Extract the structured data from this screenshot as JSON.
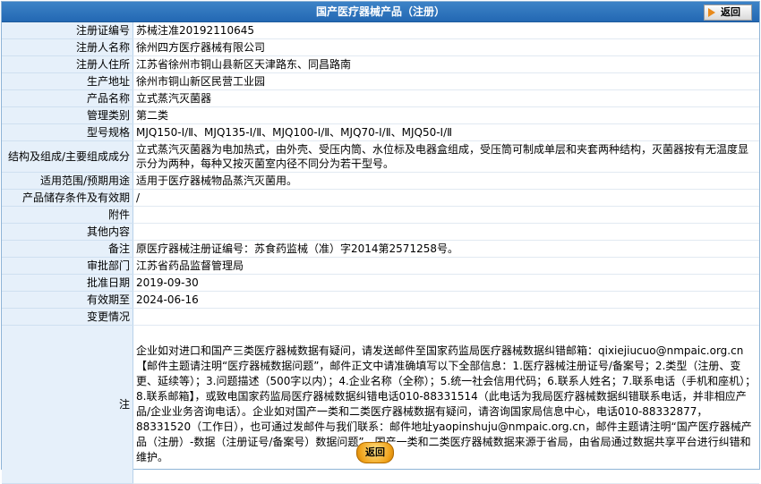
{
  "header": {
    "title": "国产医疗器械产品（注册）",
    "back_label": "返回"
  },
  "rows": [
    {
      "label": "注册证编号",
      "value": "苏械注准20192110645"
    },
    {
      "label": "注册人名称",
      "value": "徐州四方医疗器械有限公司"
    },
    {
      "label": "注册人住所",
      "value": "江苏省徐州市铜山县新区天津路东、同昌路南"
    },
    {
      "label": "生产地址",
      "value": "徐州市铜山新区民营工业园"
    },
    {
      "label": "产品名称",
      "value": "立式蒸汽灭菌器"
    },
    {
      "label": "管理类别",
      "value": "第二类"
    },
    {
      "label": "型号规格",
      "value": "MJQ150-Ⅰ/Ⅱ、MJQ135-Ⅰ/Ⅱ、MJQ100-Ⅰ/Ⅱ、MJQ70-Ⅰ/Ⅱ、MJQ50-Ⅰ/Ⅱ"
    },
    {
      "label": "结构及组成/主要组成成分",
      "value": "立式蒸汽灭菌器为电加热式，由外壳、受压内筒、水位标及电器盒组成，受压筒可制成单层和夹套两种结构，灭菌器按有无温度显示分为两种，每种又按灭菌室内径不同分为若干型号。"
    },
    {
      "label": "适用范围/预期用途",
      "value": "适用于医疗器械物品蒸汽灭菌用。"
    },
    {
      "label": "产品储存条件及有效期",
      "value": "/"
    },
    {
      "label": "附件",
      "value": ""
    },
    {
      "label": "其他内容",
      "value": ""
    },
    {
      "label": "备注",
      "value": "原医疗器械注册证编号：苏食药监械（准）字2014第2571258号。"
    },
    {
      "label": "审批部门",
      "value": "江苏省药品监督管理局"
    },
    {
      "label": "批准日期",
      "value": "2019-09-30"
    },
    {
      "label": "有效期至",
      "value": "2024-06-16"
    },
    {
      "label": "变更情况",
      "value": ""
    },
    {
      "label": "注",
      "value": "企业如对进口和国产三类医疗器械数据有疑问，请发送邮件至国家药监局医疗器械数据纠错邮箱：qixiejiucuo@nmpaic.org.cn【邮件主题请注明“医疗器械数据问题”，邮件正文中请准确填写以下全部信息：1.医疗器械注册证号/备案号；2.类型（注册、变更、延续等）；3.问题描述（500字以内）；4.企业名称（全称）；5.统一社会信用代码；6.联系人姓名；7.联系电话（手机和座机）；8.联系邮箱】，或致电国家药监局医疗器械数据纠错电话010-88331514（此电话为我局医疗器械数据纠错联系电话，并非相应产品/企业业务咨询电话）。企业如对国产一类和二类医疗器械数据有疑问，请咨询国家局信息中心，电话010-88332877，88331520（工作日），也可通过发邮件与我们联系：邮件地址yaopinshuju@nmpaic.org.cn，邮件主题请注明“国产医疗器械产品（注册）-数据（注册证号/备案号）数据问题”。国产一类和二类医疗器械数据来源于省局，由省局通过数据共享平台进行纠错和维护。"
    }
  ],
  "footer": {
    "back_label": "返回"
  }
}
